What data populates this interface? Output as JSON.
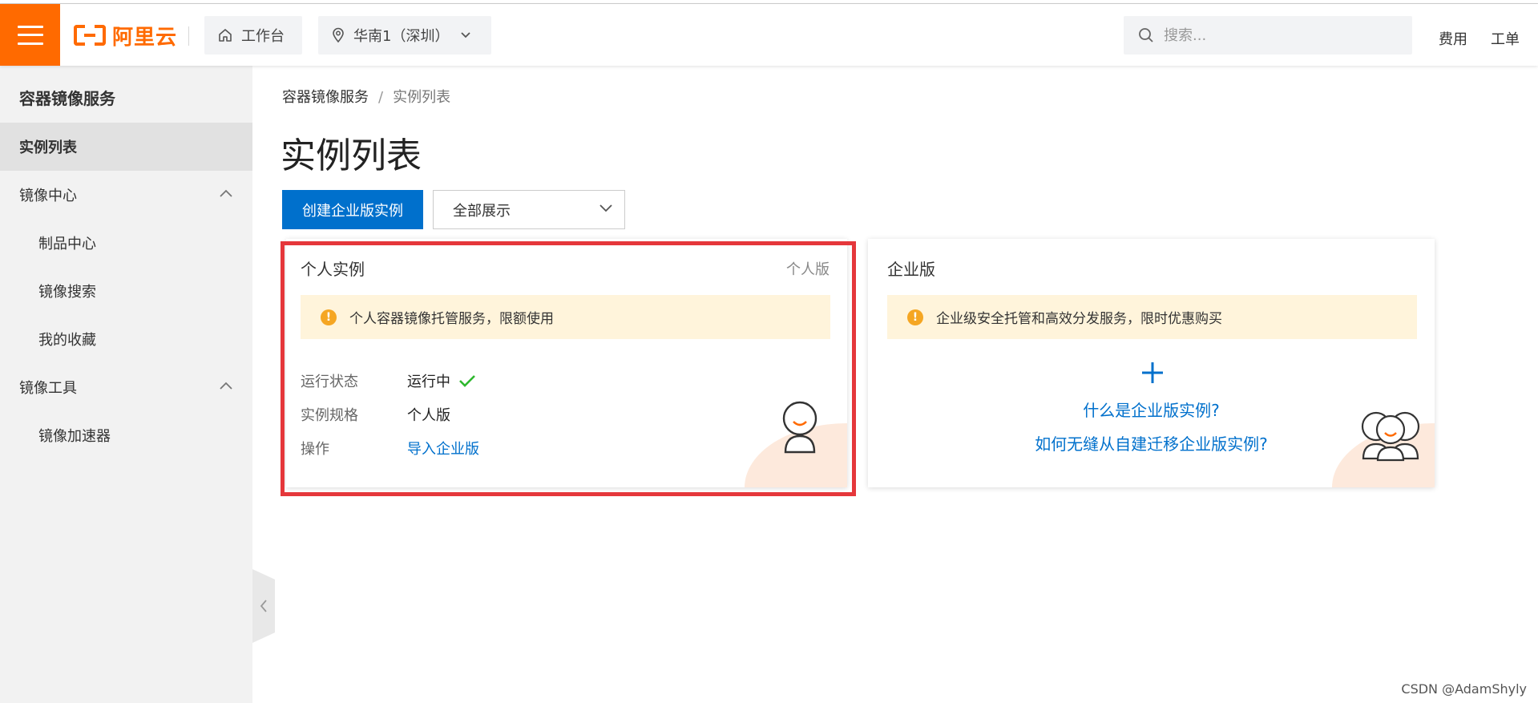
{
  "topbar": {
    "logo_text": "阿里云",
    "workbench": "工作台",
    "region": "华南1（深圳）",
    "search_placeholder": "搜索...",
    "links": [
      "费用",
      "工单"
    ],
    "brand_color": "#ff6a00"
  },
  "sidebar": {
    "title": "容器镜像服务",
    "items": [
      {
        "label": "实例列表",
        "active": true
      },
      {
        "label": "镜像中心",
        "expanded": true
      },
      {
        "label": "制品中心"
      },
      {
        "label": "镜像搜索"
      },
      {
        "label": "我的收藏"
      },
      {
        "label": "镜像工具",
        "expanded": true
      },
      {
        "label": "镜像加速器"
      }
    ]
  },
  "breadcrumb": {
    "root": "容器镜像服务",
    "separator": "/",
    "current": "实例列表"
  },
  "page": {
    "title": "实例列表",
    "create_button": "创建企业版实例",
    "filter_select": "全部展示"
  },
  "cards": {
    "personal": {
      "title": "个人实例",
      "tag": "个人版",
      "notice": "个人容器镜像托管服务，限额使用",
      "rows": [
        {
          "key": "运行状态",
          "value": "运行中"
        },
        {
          "key": "实例规格",
          "value": "个人版"
        },
        {
          "key": "操作",
          "value": "导入企业版"
        }
      ]
    },
    "enterprise": {
      "title": "企业版",
      "notice": "企业级安全托管和高效分发服务，限时优惠购买",
      "links": [
        "什么是企业版实例?",
        "如何无缝从自建迁移企业版实例?"
      ]
    }
  },
  "watermark": "CSDN @AdamShyly",
  "colors": {
    "primary": "#0070cc",
    "highlight": "#e5373b",
    "success": "#2eb82e",
    "warning": "#f5a623"
  }
}
